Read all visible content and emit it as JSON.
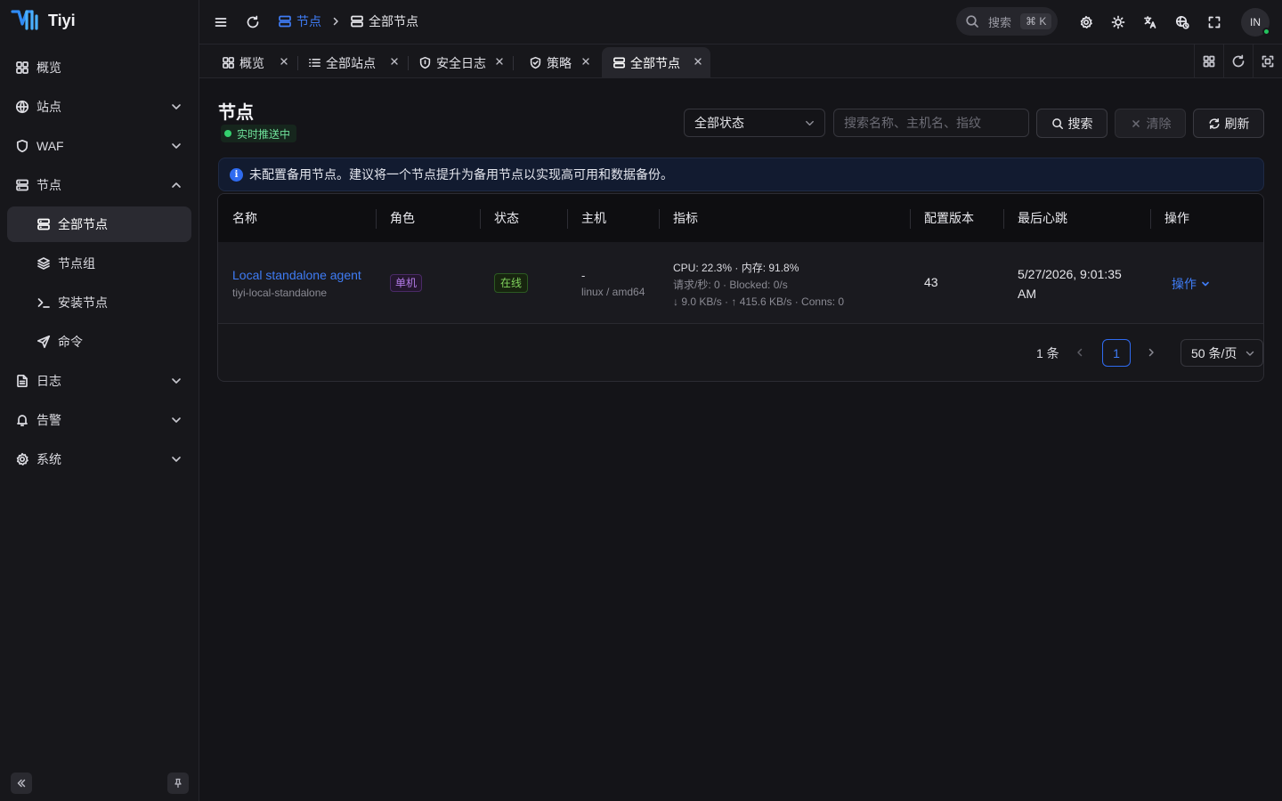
{
  "app": {
    "name": "Tiyi"
  },
  "colors": {
    "accent": "#3f7cf5",
    "success": "#34d06e",
    "background": "#141418",
    "sidebar": "#17171b"
  },
  "sidebar": {
    "items": [
      {
        "label": "概览",
        "icon": "dashboard-icon"
      },
      {
        "label": "站点",
        "icon": "globe-icon"
      },
      {
        "label": "WAF",
        "icon": "shield-icon"
      },
      {
        "label": "节点",
        "icon": "server-icon"
      },
      {
        "label": "全部节点",
        "icon": "server-icon"
      },
      {
        "label": "节点组",
        "icon": "layers-icon"
      },
      {
        "label": "安装节点",
        "icon": "terminal-icon"
      },
      {
        "label": "命令",
        "icon": "send-icon"
      },
      {
        "label": "日志",
        "icon": "file-text-icon"
      },
      {
        "label": "告警",
        "icon": "bell-icon"
      },
      {
        "label": "系统",
        "icon": "gear-icon"
      }
    ]
  },
  "header": {
    "breadcrumb": [
      "节点",
      "全部节点"
    ],
    "search_label": "搜索",
    "search_shortcut": "⌘ K",
    "avatar_initials": "IN"
  },
  "tabs": [
    {
      "label": "概览",
      "icon": "dashboard-icon"
    },
    {
      "label": "全部站点",
      "icon": "list-icon"
    },
    {
      "label": "安全日志",
      "icon": "shield-icon"
    },
    {
      "label": "策略",
      "icon": "shield-check-icon"
    },
    {
      "label": "全部节点",
      "icon": "server-icon",
      "active": true
    }
  ],
  "page": {
    "title": "节点",
    "live_status": "实时推送中",
    "status_filter": "全部状态",
    "search_placeholder": "搜索名称、主机名、指纹",
    "search_button": "搜索",
    "clear_button": "清除",
    "refresh_button": "刷新",
    "alert": "未配置备用节点。建议将一个节点提升为备用节点以实现高可用和数据备份。"
  },
  "table": {
    "columns": [
      "名称",
      "角色",
      "状态",
      "主机",
      "指标",
      "配置版本",
      "最后心跳",
      "操作"
    ],
    "rows": [
      {
        "name": "Local standalone agent",
        "id": "tiyi-local-standalone",
        "role": "单机",
        "status": "在线",
        "host": "-",
        "platform": "linux / amd64",
        "metrics_line1": "CPU: 22.3% · 内存: 91.8%",
        "metrics_line2": "请求/秒: 0 · Blocked: 0/s",
        "metrics_line3": "↓ 9.0 KB/s · ↑ 415.6 KB/s · Conns: 0",
        "config_version": "43",
        "last_heartbeat_line1": "5/27/2026, 9:01:35",
        "last_heartbeat_line2": "AM",
        "action": "操作"
      }
    ]
  },
  "pagination": {
    "total": "1 条",
    "current_page": "1",
    "page_size": "50 条/页"
  }
}
